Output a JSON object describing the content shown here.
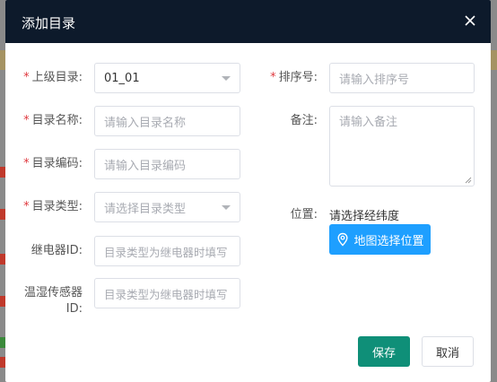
{
  "dialog": {
    "title": "添加目录",
    "close_icon": "close-icon"
  },
  "form": {
    "parent": {
      "label": "上级目录:",
      "value": "01_01",
      "required": true
    },
    "name": {
      "label": "目录名称:",
      "placeholder": "请输入目录名称",
      "required": true
    },
    "code": {
      "label": "目录编码:",
      "placeholder": "请输入目录编码",
      "required": true
    },
    "type": {
      "label": "目录类型:",
      "placeholder": "请选择目录类型",
      "required": true
    },
    "relay_id": {
      "label": "继电器ID:",
      "placeholder": "目录类型为继电器时填写",
      "required": false
    },
    "sensor_id": {
      "label": "温湿传感器\nID:",
      "label_line1": "温湿传感器",
      "label_line2": "ID:",
      "placeholder": "目录类型为继电器时填写",
      "required": false
    },
    "sort": {
      "label": "排序号:",
      "placeholder": "请输入排序号",
      "required": true
    },
    "remark": {
      "label": "备注:",
      "placeholder": "请输入备注",
      "required": false
    },
    "location": {
      "label": "位置:",
      "hint": "请选择经纬度",
      "button_label": "地图选择位置",
      "button_icon": "map-pin-icon"
    }
  },
  "footer": {
    "save_label": "保存",
    "cancel_label": "取消"
  },
  "colors": {
    "header_bg": "#0d1a2b",
    "required_mark": "#e0383e",
    "map_button": "#1e9fff",
    "save_button": "#0f8f78"
  }
}
